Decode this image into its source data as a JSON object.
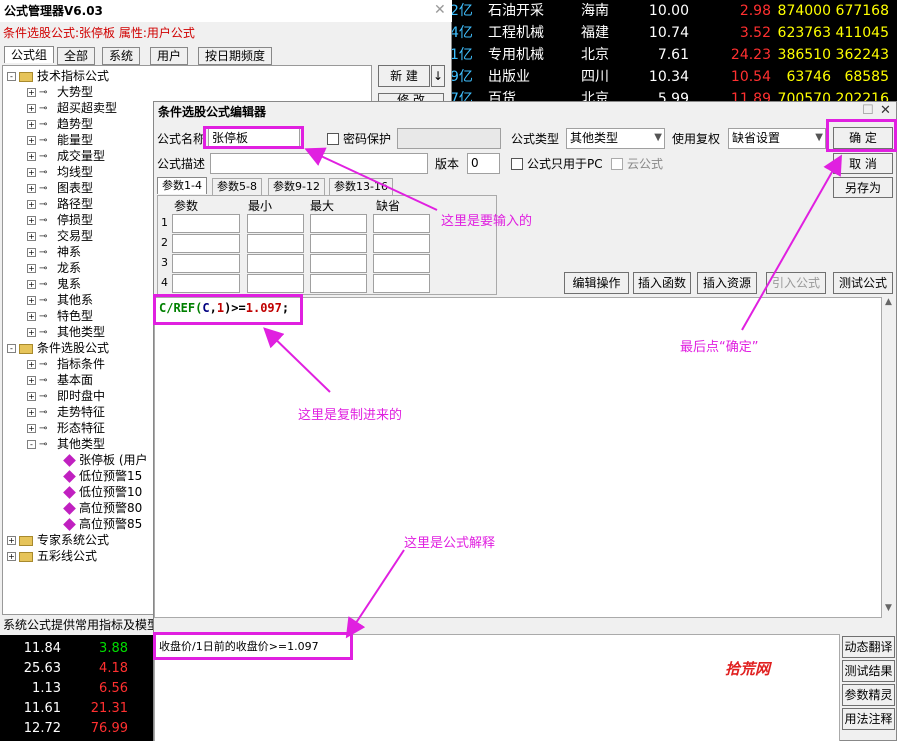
{
  "stock_list": {
    "rows": [
      {
        "cap": "2亿",
        "name": "石油开采",
        "region": "海南",
        "price": "10.00",
        "pct": "2.98",
        "vol1": "874000",
        "vol2": "677168"
      },
      {
        "cap": "4亿",
        "name": "工程机械",
        "region": "福建",
        "price": "10.74",
        "pct": "3.52",
        "vol1": "623763",
        "vol2": "411045"
      },
      {
        "cap": "1亿",
        "name": "专用机械",
        "region": "北京",
        "price": "7.61",
        "pct": "24.23",
        "vol1": "386510",
        "vol2": "362243"
      },
      {
        "cap": "9亿",
        "name": "出版业",
        "region": "四川",
        "price": "10.34",
        "pct": "10.54",
        "vol1": "63746",
        "vol2": "68585"
      },
      {
        "cap": "7亿",
        "name": "百货",
        "region": "北京",
        "price": "5.99",
        "pct": "11.89",
        "vol1": "700570",
        "vol2": "202216"
      }
    ]
  },
  "bottom_left_quotes": [
    {
      "a": "11.84",
      "b": "3.88"
    },
    {
      "a": "25.63",
      "b": "4.18"
    },
    {
      "a": "1.13",
      "b": "6.56"
    },
    {
      "a": "11.61",
      "b": "21.31"
    },
    {
      "a": "12.72",
      "b": "76.99"
    }
  ],
  "manager": {
    "title": "公式管理器V6.03",
    "subtitle": "条件选股公式:张停板 属性:用户公式",
    "tabs": [
      "公式组",
      "全部",
      "系统",
      "用户",
      "按日期频度"
    ],
    "new_label": "新 建",
    "new_arrow": "↓",
    "modify_label": "修 改",
    "status_text": "系统公式提供常用指标及模型",
    "tree": {
      "group1": "技术指标公式",
      "group1_items": [
        "大势型",
        "超买超卖型",
        "趋势型",
        "能量型",
        "成交量型",
        "均线型",
        "图表型",
        "路径型",
        "停损型",
        "交易型",
        "神系",
        "龙系",
        "鬼系",
        "其他系",
        "特色型",
        "其他类型"
      ],
      "group2": "条件选股公式",
      "group2_items": [
        "指标条件",
        "基本面",
        "即时盘中",
        "走势特征",
        "形态特征",
        "其他类型"
      ],
      "group2_leaves": [
        "张停板 (用户",
        "低位预警15",
        "低位预警10",
        "高位预警80",
        "高位预警85"
      ],
      "group3": "专家系统公式",
      "group4": "五彩线公式"
    }
  },
  "editor": {
    "title": "条件选股公式编辑器",
    "name_label": "公式名称",
    "name_value": "张停板",
    "password_label": "密码保护",
    "type_label": "公式类型",
    "type_value": "其他类型",
    "rights_label": "使用复权",
    "rights_value": "缺省设置",
    "ok_label": "确 定",
    "cancel_label": "取 消",
    "saveas_label": "另存为",
    "desc_label": "公式描述",
    "version_label": "版本",
    "version_value": "0",
    "pc_only_label": "公式只用于PC",
    "cloud_label": "云公式",
    "param_tabs": [
      "参数1-4",
      "参数5-8",
      "参数9-12",
      "参数13-16"
    ],
    "param_headers": [
      "参数",
      "最小",
      "最大",
      "缺省"
    ],
    "param_rows": [
      "1",
      "2",
      "3",
      "4"
    ],
    "action_buttons": [
      "编辑操作",
      "插入函数",
      "插入资源",
      "引入公式",
      "测试公式"
    ],
    "code_parts": [
      "C/REF(",
      "C",
      ",",
      "1",
      ")>=",
      "1.097",
      ";"
    ],
    "explain_text": "收盘价/1日前的收盘价>=1.097",
    "side_buttons": [
      "动态翻译",
      "测试结果",
      "参数精灵",
      "用法注释"
    ],
    "watermark": "拾荒网"
  },
  "annotations": {
    "input_note": "这里是要输入的",
    "copy_note": "这里是复制进来的",
    "ok_note": "最后点“确定”",
    "explain_note": "这里是公式解释"
  },
  "colors": {
    "highlight": "#e020e0",
    "up_red": "#ff3030",
    "down_green": "#00dd00"
  }
}
